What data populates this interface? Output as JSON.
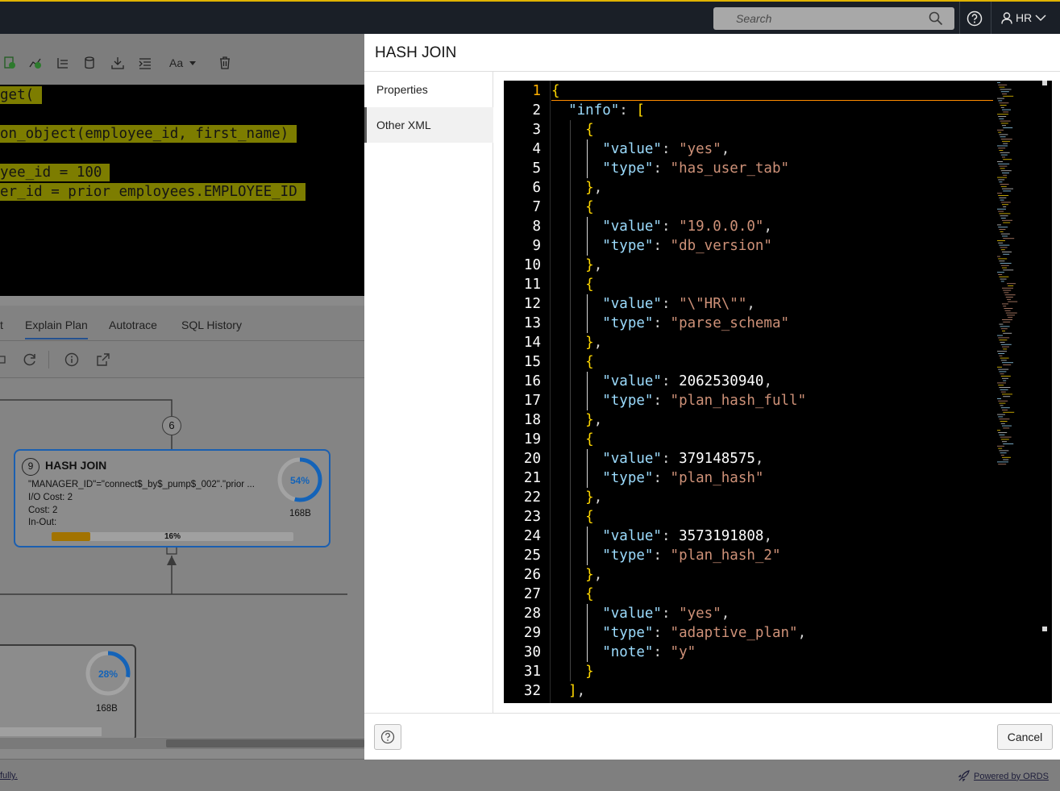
{
  "topbar": {
    "search_placeholder": "Search",
    "user_label": "HR",
    "accent_color": "#e0b300"
  },
  "editor": {
    "lines": [
      "get(",
      "on_object(employee_id, first_name)",
      "yee_id = 100",
      "er_id = prior employees.EMPLOYEE_ID"
    ]
  },
  "lower_panel": {
    "tabs": [
      {
        "label": "t"
      },
      {
        "label": "Explain Plan",
        "active": true
      },
      {
        "label": "Autotrace"
      },
      {
        "label": "SQL History"
      }
    ]
  },
  "plan": {
    "connector_num": "6",
    "hash_join_node": {
      "num": "9",
      "title": "HASH JOIN",
      "predicate": "\"MANAGER_ID\"=\"connect$_by$_pump$_002\".\"prior ...",
      "io_cost": "I/O Cost: 2",
      "cost": "Cost: 2",
      "in_out": "In-Out:",
      "ring_percent": "54%",
      "ring_value": 54,
      "bytes": "168B",
      "bar_label": "16%",
      "bar_value": 16
    },
    "lower_node": {
      "ring_percent": "28%",
      "ring_value": 28,
      "bytes": "168B"
    }
  },
  "footer": {
    "status_text": "fully.",
    "powered_by": "Powered by ORDS"
  },
  "dialog": {
    "title": "HASH JOIN",
    "side_items": [
      {
        "label": "Properties",
        "active": false
      },
      {
        "label": "Other XML",
        "active": true
      }
    ],
    "cancel_label": "Cancel",
    "code_lines": [
      "{",
      "  \"info\": [",
      "    {",
      "      \"value\": \"yes\",",
      "      \"type\": \"has_user_tab\"",
      "    },",
      "    {",
      "      \"value\": \"19.0.0.0\",",
      "      \"type\": \"db_version\"",
      "    },",
      "    {",
      "      \"value\": \"\\\"HR\\\"\",",
      "      \"type\": \"parse_schema\"",
      "    },",
      "    {",
      "      \"value\": 2062530940,",
      "      \"type\": \"plan_hash_full\"",
      "    },",
      "    {",
      "      \"value\": 379148575,",
      "      \"type\": \"plan_hash\"",
      "    },",
      "    {",
      "      \"value\": 3573191808,",
      "      \"type\": \"plan_hash_2\"",
      "    },",
      "    {",
      "      \"value\": \"yes\",",
      "      \"type\": \"adaptive_plan\",",
      "      \"note\": \"y\"",
      "    }",
      "  ],"
    ]
  }
}
